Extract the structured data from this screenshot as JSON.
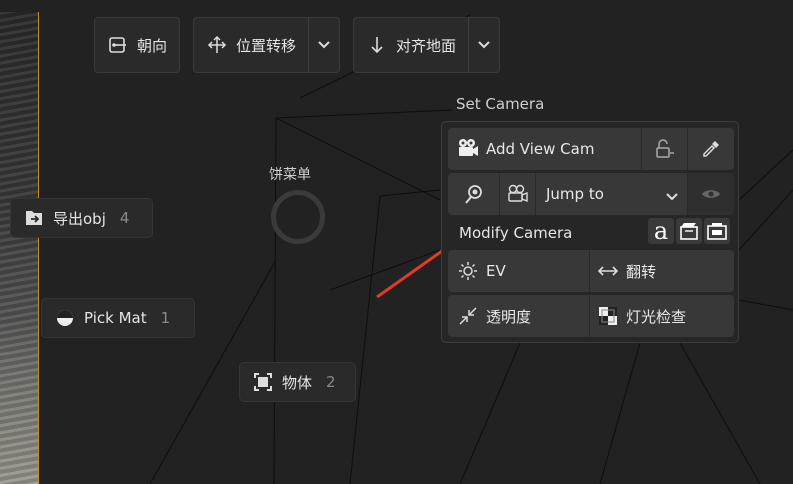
{
  "toolbar": {
    "orient_label": "朝向",
    "move_label": "位置转移",
    "align_label": "对齐地面"
  },
  "pie_menu": {
    "title": "饼菜单",
    "items": [
      {
        "label": "导出obj",
        "shortcut": "4"
      },
      {
        "label": "Pick Mat",
        "shortcut": "1"
      },
      {
        "label": "物体",
        "shortcut": "2"
      }
    ]
  },
  "panel": {
    "title": "Set Camera",
    "add_view_cam": "Add View Cam",
    "jump_to": "Jump to",
    "modify_camera": "Modify Camera",
    "ev": "EV",
    "flip": "翻转",
    "transparency": "透明度",
    "light_check": "灯光检查"
  },
  "colors": {
    "accent_arrow": "#e53a2a",
    "photo_border": "#c88a2a"
  }
}
